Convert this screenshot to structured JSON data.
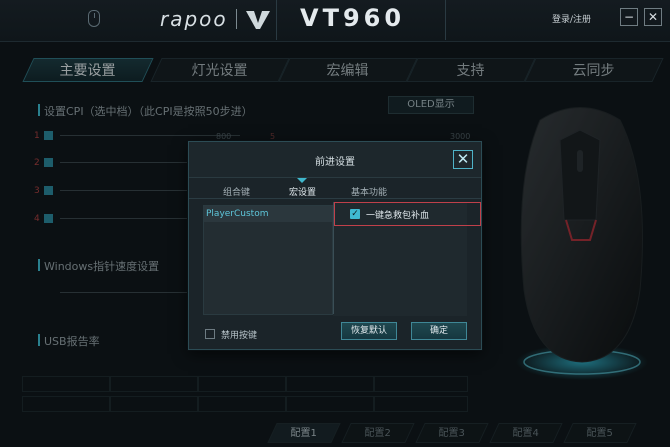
{
  "header": {
    "brand": "rapoo",
    "model": "VT960",
    "login_label": "登录/注册",
    "minimize_label": "−",
    "close_label": "✕"
  },
  "main_tabs": [
    {
      "label": "主要设置",
      "active": true
    },
    {
      "label": "灯光设置",
      "active": false
    },
    {
      "label": "宏编辑",
      "active": false
    },
    {
      "label": "支持",
      "active": false
    },
    {
      "label": "云同步",
      "active": false
    }
  ],
  "dpi_section": {
    "title": "设置CPI（选中档）（此CPI是按照50步进）",
    "oled_button": "OLED显示",
    "rows": [
      {
        "num": "1"
      },
      {
        "num": "2"
      },
      {
        "num": "3"
      },
      {
        "num": "4"
      }
    ],
    "value_1": "800",
    "value_5_num": "5",
    "value_5": "3000"
  },
  "pointer_section": {
    "title": "Windows指针速度设置"
  },
  "usb_section": {
    "title": "USB报告率"
  },
  "configs": [
    {
      "label": "配置1",
      "active": true
    },
    {
      "label": "配置2",
      "active": false
    },
    {
      "label": "配置3",
      "active": false
    },
    {
      "label": "配置4",
      "active": false
    },
    {
      "label": "配置5",
      "active": false
    }
  ],
  "dialog": {
    "title": "前进设置",
    "close_label": "✕",
    "tabs": [
      {
        "label": "组合键",
        "active": false
      },
      {
        "label": "宏设置",
        "active": true
      },
      {
        "label": "基本功能",
        "active": false
      }
    ],
    "macro_list": [
      "PlayerCustom"
    ],
    "function_item": {
      "label": "一键急救包补血",
      "checked": true
    },
    "disable_hotkey_label": "禁用按键",
    "restore_default_label": "恢复默认",
    "confirm_label": "确定"
  },
  "colors": {
    "accent": "#3fb9d1",
    "highlight_border": "#c0404a",
    "background": "#0e1519"
  }
}
